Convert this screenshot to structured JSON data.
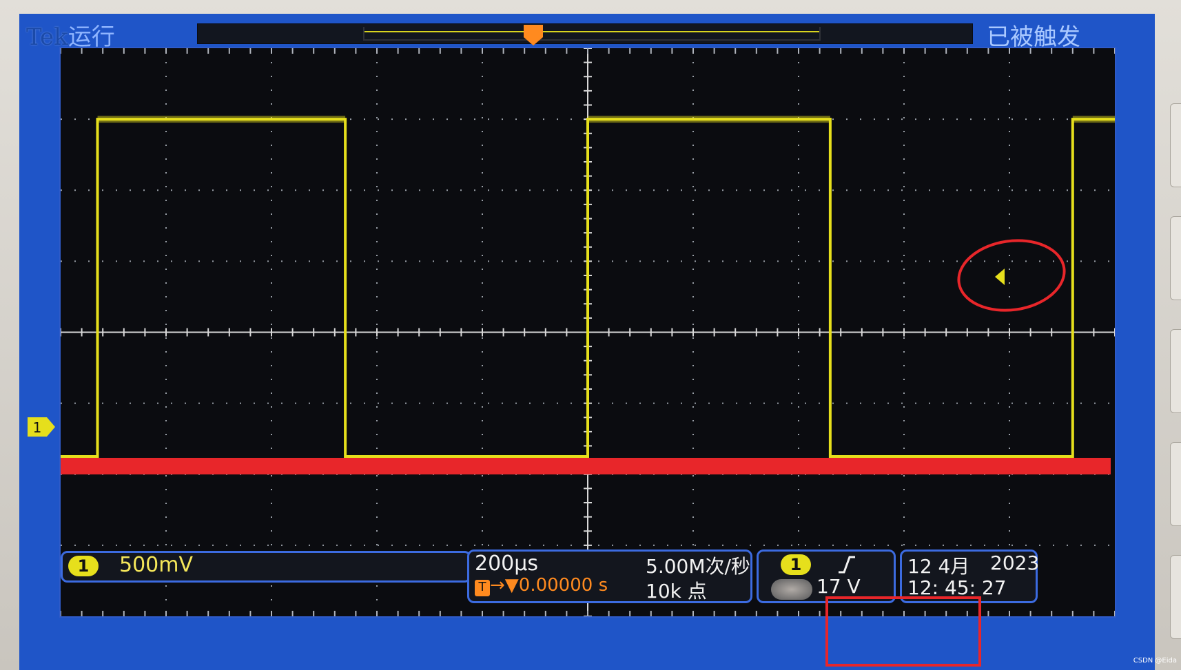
{
  "header": {
    "brand": "Tek",
    "run_state": "运行",
    "trigger_status": "已被触发"
  },
  "channel": {
    "number": "1",
    "scale": "500mV",
    "trace_color": "#e6df1c"
  },
  "timebase": {
    "time_per_div": "200µs",
    "trigger_marker": "T",
    "delay": "0.00000 s",
    "sample_rate": "5.00M次/秒",
    "record_length": "10k 点"
  },
  "trigger": {
    "source": "1",
    "slope_icon": "rising-edge-icon",
    "level": "17 V"
  },
  "clock": {
    "date": "12 4月",
    "year": "2023",
    "time": "12: 45: 27"
  },
  "markers": {
    "ground_marker": "1",
    "trigger_level_icon": "arrow-left-icon"
  },
  "watermark": "CSDN @Eida",
  "colors": {
    "screen_blue": "#1f55c8",
    "trace_yellow": "#e6df1c",
    "annotation_red": "#e8262a",
    "trigger_orange": "#ff8a1f"
  },
  "chart_data": {
    "type": "line",
    "title": "",
    "xlabel": "",
    "ylabel": "",
    "grid": true,
    "x_divisions": 10,
    "y_divisions": 8,
    "series": [
      {
        "name": "1",
        "x_div": [
          0,
          0.35,
          0.35,
          2.7,
          2.7,
          5.0,
          5.0,
          7.3,
          7.3,
          9.6,
          9.6,
          10
        ],
        "y_div": [
          -1.75,
          -1.75,
          3.0,
          3.0,
          -1.75,
          -1.75,
          3.0,
          3.0,
          -1.75,
          -1.75,
          3.0,
          3.0
        ]
      }
    ]
  }
}
